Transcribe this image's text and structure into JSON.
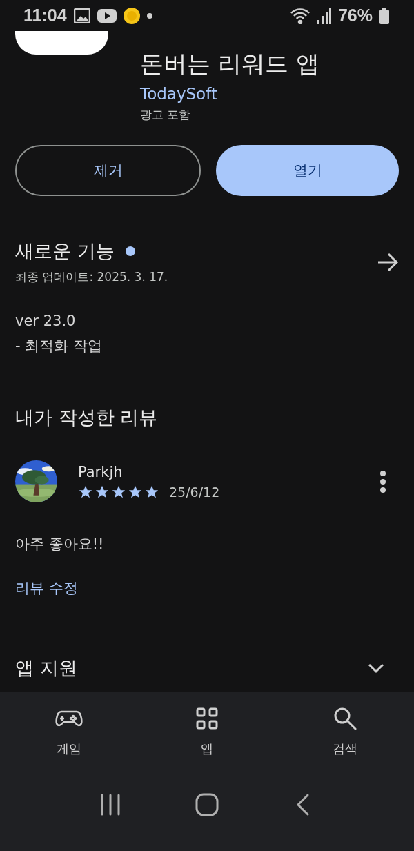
{
  "status_bar": {
    "time": "11:04",
    "battery": "76%"
  },
  "app": {
    "title": "돈버는 리워드 앱",
    "developer": "TodaySoft",
    "ads_note": "광고 포함"
  },
  "actions": [
    {
      "label": "제거",
      "kind": "outline"
    },
    {
      "label": "열기",
      "kind": "filled"
    }
  ],
  "whats_new": {
    "title": "새로운 기능",
    "unread": true,
    "updated": "최종 업데이트: 2025. 3. 17.",
    "version": "ver 23.0",
    "notes": "- 최적화 작업"
  },
  "my_review": {
    "title": "내가 작성한 리뷰",
    "author": "Parkjh",
    "stars": 5,
    "date": "25/6/12",
    "text": "아주 좋아요!!",
    "edit_link": "리뷰 수정"
  },
  "app_support": {
    "title": "앱 지원",
    "expanded": false
  },
  "bottom_nav": [
    {
      "label": "게임",
      "kind": "games"
    },
    {
      "label": "앱",
      "kind": "apps"
    },
    {
      "label": "검색",
      "kind": "search"
    }
  ]
}
